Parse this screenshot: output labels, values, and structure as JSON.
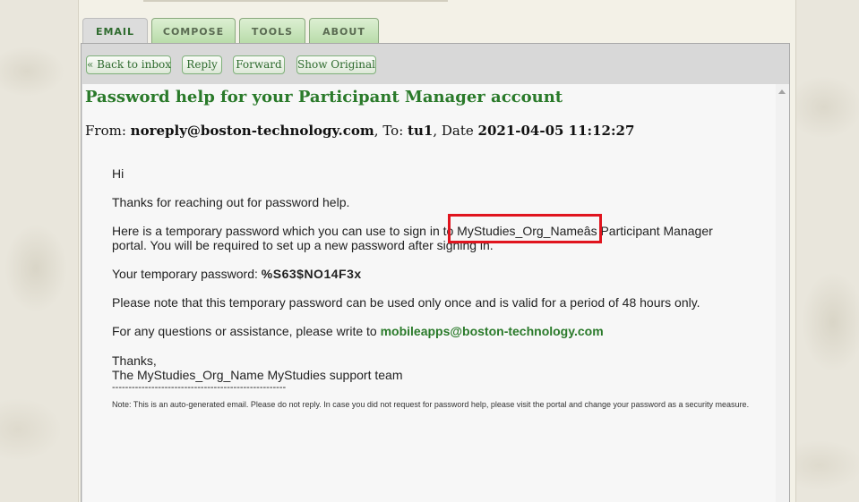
{
  "tabs": [
    {
      "label": "EMAIL",
      "active": true
    },
    {
      "label": "COMPOSE",
      "active": false
    },
    {
      "label": "TOOLS",
      "active": false
    },
    {
      "label": "ABOUT",
      "active": false
    }
  ],
  "toolbar": {
    "back_label": "« Back to inbox",
    "reply_label": "Reply",
    "forward_label": "Forward",
    "show_original_label": "Show Original"
  },
  "email": {
    "subject": "Password help for your Participant Manager account",
    "from_label": "From:",
    "from": "noreply@boston-technology.com",
    "to_label": ", To:",
    "to": "tu1",
    "date_label": ", Date",
    "date": "2021-04-05 11:12:27",
    "greeting": "Hi",
    "para1": "Thanks for reaching out for password help.",
    "para2_line1": "Here is a temporary password which you can use to sign in to MyStudies_Org_Nameâs Participant Manager",
    "para2_line2": "portal. You will be required to set up a new password after signing in.",
    "password_label": "Your temporary password: ",
    "password": "%S63$NO14F3x",
    "para3": "Please note that this temporary password can be used only once and is valid for a period of 48 hours only.",
    "para4_prefix": "For any questions or assistance, please write to ",
    "support_email": "mobileapps@boston-technology.com",
    "signoff": "Thanks,",
    "signature": "The MyStudies_Org_Name MyStudies support team",
    "separator": "-----------------------------------------------------",
    "note": "Note: This is an auto-generated email. Please do not reply. In case you did not request for password help, please visit the portal and change your password as a security measure."
  },
  "colors": {
    "accent_green": "#2a7a2a",
    "highlight_red": "#e0141e"
  }
}
